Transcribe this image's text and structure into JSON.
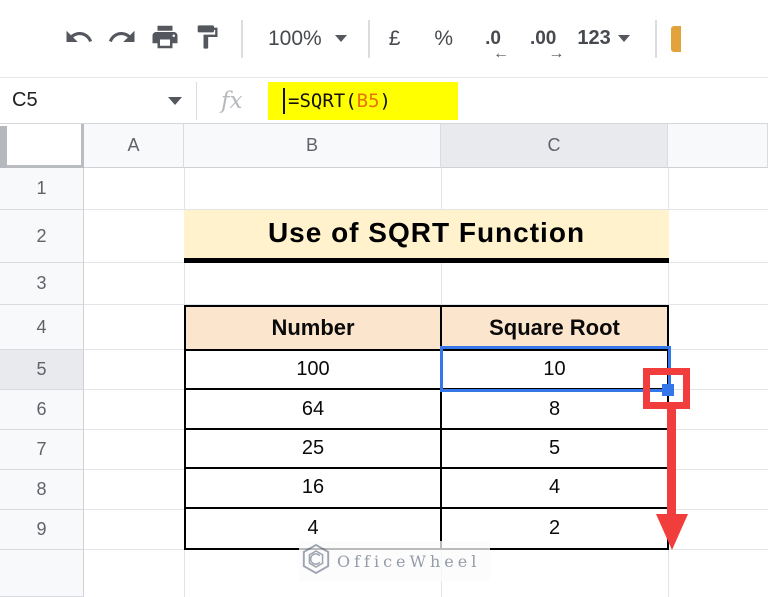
{
  "toolbar": {
    "zoom": {
      "label": "100%"
    },
    "currency_label": "£",
    "percent_label": "%",
    "decrease_decimal": {
      "label": ".0",
      "arrow": "←"
    },
    "increase_decimal": {
      "label": ".00",
      "arrow": "→"
    },
    "more_formats_label": "123",
    "swatch_color": "#E2A33C"
  },
  "formula_bar": {
    "name_box_value": "C5",
    "fx_label": "fx",
    "formula": {
      "prefix": "=SQRT(",
      "reference": "B5",
      "suffix": ")"
    },
    "colors": {
      "highlight": "#FFFF00",
      "reference": "#E8710A"
    }
  },
  "sheet": {
    "column_headers": [
      "A",
      "B",
      "C"
    ],
    "selected_column": "C",
    "row_headers": [
      "1",
      "2",
      "3",
      "4",
      "5",
      "6",
      "7",
      "8",
      "9"
    ],
    "selected_row": "5",
    "selected_cell": "C5",
    "title": {
      "text": "Use of SQRT Function",
      "bg_color": "#FFF2CC"
    },
    "table": {
      "columns": [
        "Number",
        "Square Root"
      ],
      "header_bg_color": "#FCE5CD",
      "rows": [
        {
          "number": "100",
          "square_root": "10"
        },
        {
          "number": "64",
          "square_root": "8"
        },
        {
          "number": "25",
          "square_root": "5"
        },
        {
          "number": "16",
          "square_root": "4"
        },
        {
          "number": "4",
          "square_root": "2"
        }
      ]
    },
    "selection_color": "#3577E8",
    "annotation_color": "#F23D3D"
  },
  "watermark": {
    "text": "OfficeWheel"
  }
}
